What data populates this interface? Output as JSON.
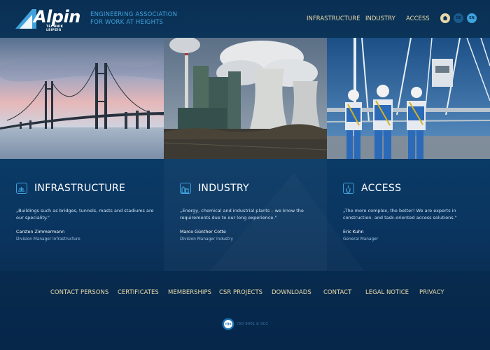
{
  "brand": {
    "name": "Alpin",
    "subname": "TECHNIK LEIPZIG",
    "tagline_line1": "ENGINEERING ASSOCIATION",
    "tagline_line2": "FOR WORK AT HEIGHTS",
    "accent": "#3fa2dd"
  },
  "topnav": {
    "items": [
      "INFRASTRUCTURE",
      "INDUSTRY",
      "ACCESS"
    ]
  },
  "util": {
    "home_icon": "home-icon",
    "lang_de": "DE",
    "lang_en": "EN"
  },
  "features": [
    {
      "icon": "infrastructure-icon",
      "title": "INFRASTRUCTURE",
      "quote": "„Buildings such as bridges, tunnels, masts and stadiums are our speciality.\"",
      "person": "Carsten Zimmermann",
      "role": "Division Manager Infrastructure"
    },
    {
      "icon": "industry-icon",
      "title": "INDUSTRY",
      "quote": "„Energy, chemical and industrial plants – we know the requirements due to our long experience.\"",
      "person": "Marco Günther Cotte",
      "role": "Division Manager Industry"
    },
    {
      "icon": "access-icon",
      "title": "ACCESS",
      "quote": "„The more complex, the better! We are experts in construction- and task-oriented access solutions.\"",
      "person": "Eric Kuhn",
      "role": "General Manager"
    }
  ],
  "footer": {
    "links": [
      "CONTACT PERSONS",
      "CERTIFICATES",
      "MEMBERSHIPS",
      "CSR PROJECTS",
      "DOWNLOADS",
      "CONTACT",
      "LEGAL NOTICE",
      "PRIVACY"
    ],
    "seal_text": "TÜV",
    "iso_text": "ISO 9001 & SCC"
  }
}
